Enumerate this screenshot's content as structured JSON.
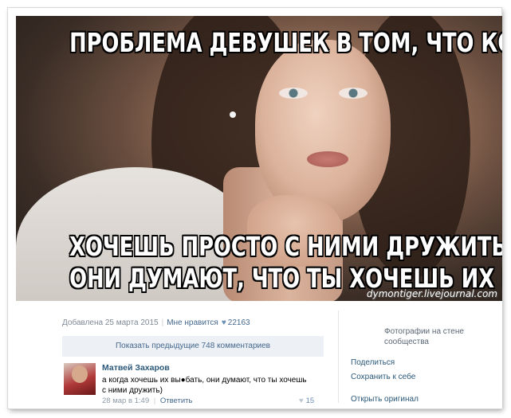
{
  "photo": {
    "caption_top": "ПРОБЛЕМА ДЕВУШЕК В ТОМ, ЧТО КОГДА ТЫ",
    "caption_bottom_1": "ХОЧЕШЬ ПРОСТО С НИМИ ДРУЖИТЬ",
    "caption_bottom_2": "ОНИ ДУМАЮТ, ЧТО ТЫ ХОЧЕШЬ ИХ ВЫЕ*АТЬ",
    "watermark": "dymontiger.livejournal.com"
  },
  "post_meta": {
    "added": "Добавлена 25 марта 2015",
    "separator": "|",
    "like_label": "Мне нравится",
    "like_icon": "heart-icon",
    "like_count": "22163"
  },
  "comments": {
    "show_previous": "Показать предыдущие 748 комментариев",
    "items": [
      {
        "author": "Матвей Захаров",
        "text": "а когда хочешь их вы●бать, они думают, что ты хочешь с ними дружить)",
        "date": "28 мар в 1:49",
        "separator": "|",
        "reply": "Ответить",
        "likes": "15"
      }
    ]
  },
  "sidebar": {
    "album": "Фотографии на стене сообщества",
    "share": "Поделиться",
    "save": "Сохранить к себе",
    "open_original": "Открыть оригинал"
  },
  "colors": {
    "link": "#2b587a",
    "accent": "#45688e",
    "muted": "#7f8a96"
  }
}
